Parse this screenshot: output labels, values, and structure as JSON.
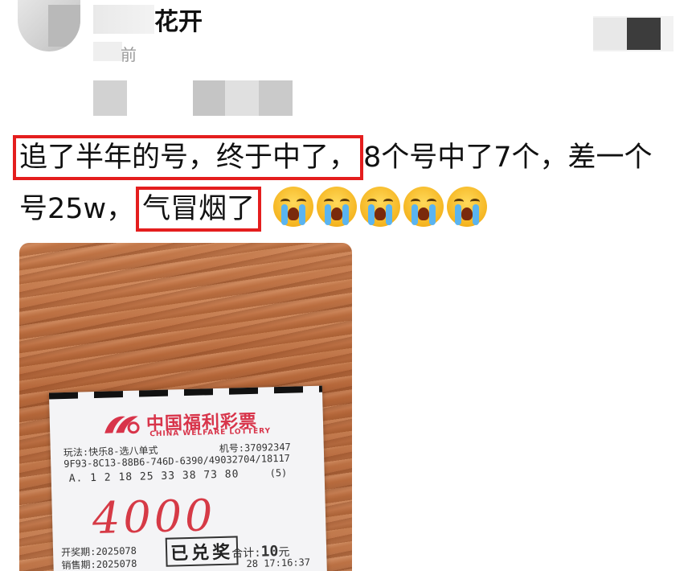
{
  "post": {
    "username_visible": "花开",
    "time_visible": "前",
    "text_line1_highlight": "追了半年的号，终于中了，",
    "text_line1_rest": "8个号中了7个，差一个",
    "text_line2_start": "号25w，",
    "text_line2_highlight": "气冒烟了",
    "emoji_name": "loudly-crying-face-icon",
    "emoji_count": 5,
    "highlight_color": "#e41e1e"
  },
  "ticket": {
    "brand_cn": "中国福利彩票",
    "brand_en": "CHINA WELFARE LOTTERY",
    "play_type": "玩法:快乐8-选八单式",
    "machine": "机号:37092347",
    "serial": "9F93-8C13-88B6-746D-6390/49032704/18117",
    "numbers": "A. 1  2 18 25 33 38 73 80",
    "multiplier": "(5)",
    "handwritten": "4000",
    "draw_period": "开奖期:2025078",
    "sale_period": "销售期:2025078",
    "stamp": "已兑奖",
    "total_label": "合计:",
    "total_value": "10",
    "total_unit": "元",
    "sale_time": "28 17:16:37",
    "brand_color": "#d8344a"
  }
}
